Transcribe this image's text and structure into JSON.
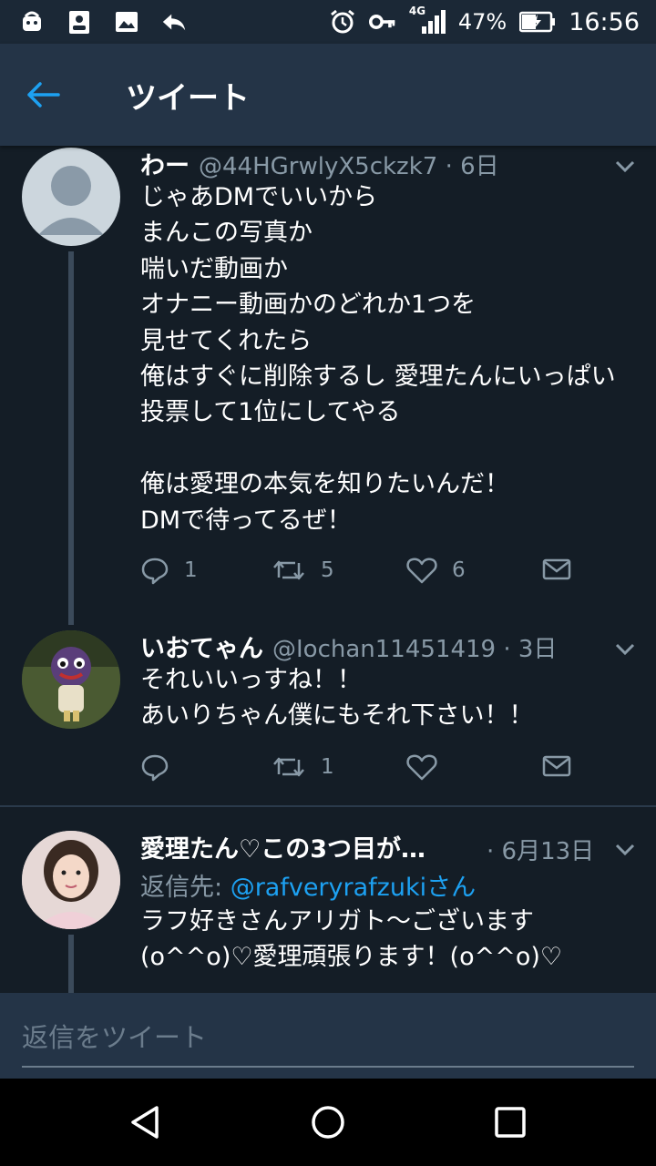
{
  "status_bar": {
    "battery": "47%",
    "network": "4G",
    "time": "16:56"
  },
  "header": {
    "title": "ツイート"
  },
  "tweets": [
    {
      "name": "わー",
      "handle": "@44HGrwlyX5ckzk7 · 6日",
      "text": "じゃあDMでいいから\nまんこの写真か\n喘いだ動画か\nオナニー動画かのどれか1つを\n見せてくれたら\n俺はすぐに削除するし 愛理たんにいっぱい投票して1位にしてやる\n\n俺は愛理の本気を知りたいんだ！\nDMで待ってるぜ！",
      "reply_count": "1",
      "retweet_count": "5",
      "like_count": "6"
    },
    {
      "name": "いおてゃん",
      "handle": "@Iochan11451419 · 3日",
      "text": "それいいっすね！！\nあいりちゃん僕にもそれ下さい！！",
      "reply_count": "",
      "retweet_count": "1",
      "like_count": ""
    },
    {
      "name": "愛理たん♡この3つ目が…",
      "handle": "· 6月13日",
      "reply_prefix": "返信先: ",
      "reply_mention": "@rafveryrafzukiさん",
      "text": "ラフ好きさんアリガト〜ございます\n(o^^o)♡愛理頑張ります！(o^^o)♡"
    }
  ],
  "composer": {
    "placeholder": "返信をツイート"
  },
  "colors": {
    "background": "#141d26",
    "header": "#243447",
    "secondary_text": "#8899a6",
    "accent": "#1da1f2"
  }
}
